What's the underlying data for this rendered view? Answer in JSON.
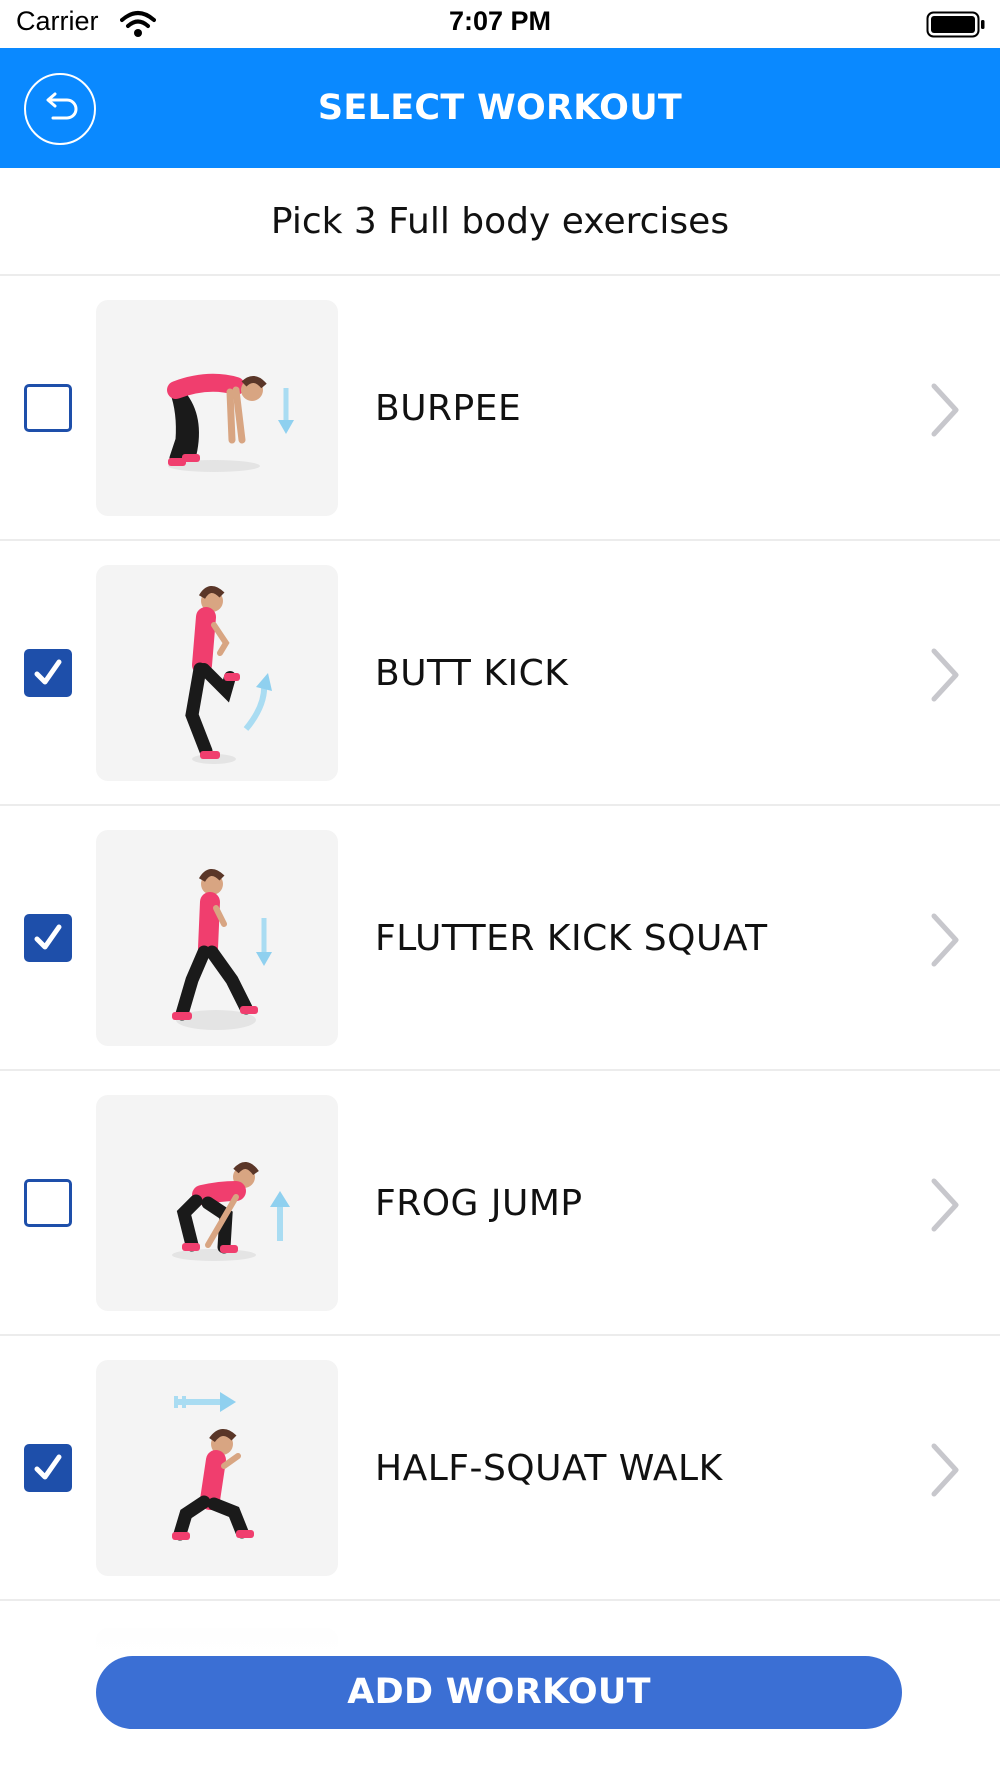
{
  "status_bar": {
    "carrier": "Carrier",
    "time": "7:07 PM",
    "icons": [
      "wifi-icon",
      "battery-icon"
    ]
  },
  "header": {
    "title": "SELECT WORKOUT",
    "back_icon": "back-arrow-icon",
    "background_color": "#0a89ff"
  },
  "subtitle": "Pick 3 Full body exercises",
  "exercises": [
    {
      "name": "BURPEE",
      "checked": false,
      "thumbnail": "burpee-illustration"
    },
    {
      "name": "BUTT KICK",
      "checked": true,
      "thumbnail": "butt-kick-illustration"
    },
    {
      "name": "FLUTTER KICK SQUAT",
      "checked": true,
      "thumbnail": "flutter-kick-squat-illustration"
    },
    {
      "name": "FROG JUMP",
      "checked": false,
      "thumbnail": "frog-jump-illustration"
    },
    {
      "name": "HALF-SQUAT WALK",
      "checked": true,
      "thumbnail": "half-squat-walk-illustration"
    }
  ],
  "add_button": {
    "label": "ADD WORKOUT",
    "color": "#3b6fd4"
  },
  "colors": {
    "checkbox": "#1e4faa",
    "accent": "#f03e6e",
    "chevron": "#c7c7cc"
  }
}
